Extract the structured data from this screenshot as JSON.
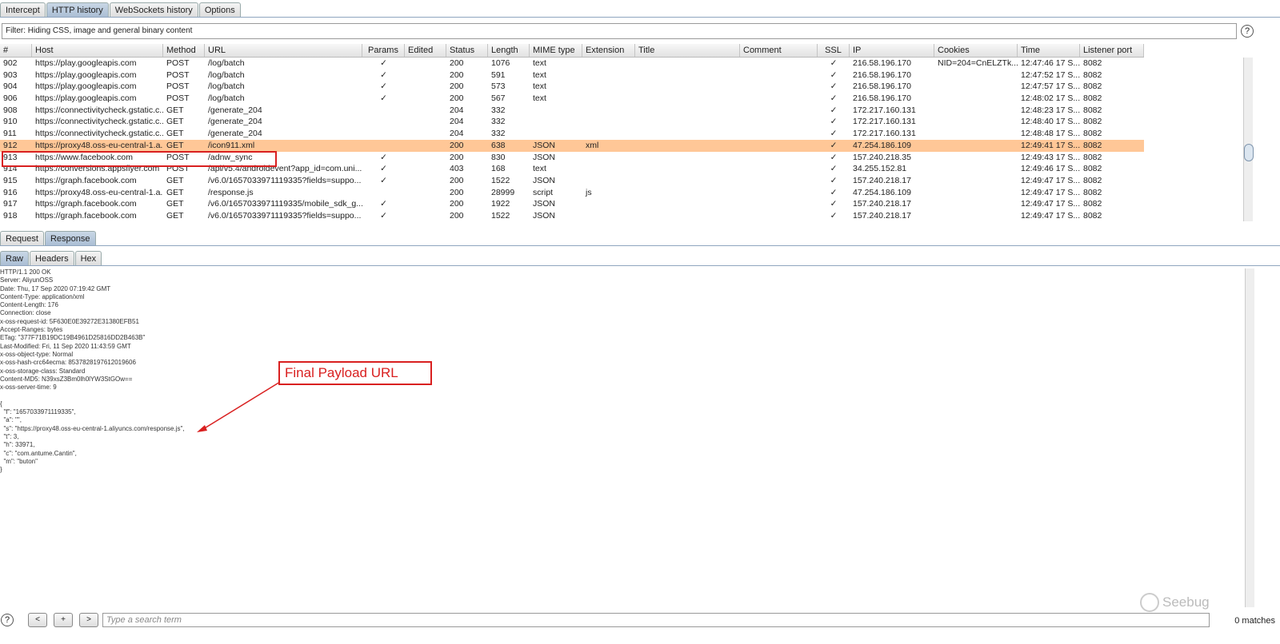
{
  "top_tabs": [
    "Intercept",
    "HTTP history",
    "WebSockets history",
    "Options"
  ],
  "filter": "Filter: Hiding CSS, image and general binary content",
  "columns": [
    "#",
    "Host",
    "Method",
    "URL",
    "Params",
    "Edited",
    "Status",
    "Length",
    "MIME type",
    "Extension",
    "Title",
    "Comment",
    "SSL",
    "IP",
    "Cookies",
    "Time",
    "Listener port"
  ],
  "rows": [
    [
      "902",
      "https://play.googleapis.com",
      "POST",
      "/log/batch",
      "✓",
      "",
      "200",
      "1076",
      "text",
      "",
      "",
      "",
      "✓",
      "216.58.196.170",
      "NID=204=CnELZTk...",
      "12:47:46 17 S...",
      "8082"
    ],
    [
      "903",
      "https://play.googleapis.com",
      "POST",
      "/log/batch",
      "✓",
      "",
      "200",
      "591",
      "text",
      "",
      "",
      "",
      "✓",
      "216.58.196.170",
      "",
      "12:47:52 17 S...",
      "8082"
    ],
    [
      "904",
      "https://play.googleapis.com",
      "POST",
      "/log/batch",
      "✓",
      "",
      "200",
      "573",
      "text",
      "",
      "",
      "",
      "✓",
      "216.58.196.170",
      "",
      "12:47:57 17 S...",
      "8082"
    ],
    [
      "906",
      "https://play.googleapis.com",
      "POST",
      "/log/batch",
      "✓",
      "",
      "200",
      "567",
      "text",
      "",
      "",
      "",
      "✓",
      "216.58.196.170",
      "",
      "12:48:02 17 S...",
      "8082"
    ],
    [
      "908",
      "https://connectivitycheck.gstatic.c...",
      "GET",
      "/generate_204",
      "",
      "",
      "204",
      "332",
      "",
      "",
      "",
      "",
      "✓",
      "172.217.160.131",
      "",
      "12:48:23 17 S...",
      "8082"
    ],
    [
      "910",
      "https://connectivitycheck.gstatic.c...",
      "GET",
      "/generate_204",
      "",
      "",
      "204",
      "332",
      "",
      "",
      "",
      "",
      "✓",
      "172.217.160.131",
      "",
      "12:48:40 17 S...",
      "8082"
    ],
    [
      "911",
      "https://connectivitycheck.gstatic.c...",
      "GET",
      "/generate_204",
      "",
      "",
      "204",
      "332",
      "",
      "",
      "",
      "",
      "✓",
      "172.217.160.131",
      "",
      "12:48:48 17 S...",
      "8082"
    ],
    [
      "912",
      "https://proxy48.oss-eu-central-1.a...",
      "GET",
      "/icon911.xml",
      "",
      "",
      "200",
      "638",
      "JSON",
      "xml",
      "",
      "",
      "✓",
      "47.254.186.109",
      "",
      "12:49:41 17 S...",
      "8082"
    ],
    [
      "913",
      "https://www.facebook.com",
      "POST",
      "/adnw_sync",
      "✓",
      "",
      "200",
      "830",
      "JSON",
      "",
      "",
      "",
      "✓",
      "157.240.218.35",
      "",
      "12:49:43 17 S...",
      "8082"
    ],
    [
      "914",
      "https://conversions.appsflyer.com",
      "POST",
      "/api/v5.4/androidevent?app_id=com.uni...",
      "✓",
      "",
      "403",
      "168",
      "text",
      "",
      "",
      "",
      "✓",
      "34.255.152.81",
      "",
      "12:49:46 17 S...",
      "8082"
    ],
    [
      "915",
      "https://graph.facebook.com",
      "GET",
      "/v6.0/1657033971119335?fields=suppo...",
      "✓",
      "",
      "200",
      "1522",
      "JSON",
      "",
      "",
      "",
      "✓",
      "157.240.218.17",
      "",
      "12:49:47 17 S...",
      "8082"
    ],
    [
      "916",
      "https://proxy48.oss-eu-central-1.a...",
      "GET",
      "/response.js",
      "",
      "",
      "200",
      "28999",
      "script",
      "js",
      "",
      "",
      "✓",
      "47.254.186.109",
      "",
      "12:49:47 17 S...",
      "8082"
    ],
    [
      "917",
      "https://graph.facebook.com",
      "GET",
      "/v6.0/1657033971119335/mobile_sdk_g...",
      "✓",
      "",
      "200",
      "1922",
      "JSON",
      "",
      "",
      "",
      "✓",
      "157.240.218.17",
      "",
      "12:49:47 17 S...",
      "8082"
    ],
    [
      "918",
      "https://graph.facebook.com",
      "GET",
      "/v6.0/1657033971119335?fields=suppo...",
      "✓",
      "",
      "200",
      "1522",
      "JSON",
      "",
      "",
      "",
      "✓",
      "157.240.218.17",
      "",
      "12:49:47 17 S...",
      "8082"
    ]
  ],
  "selected_row": "912",
  "msg_tabs": [
    "Request",
    "Response"
  ],
  "view_tabs": [
    "Raw",
    "Headers",
    "Hex"
  ],
  "response_raw": "HTTP/1.1 200 OK\nServer: AliyunOSS\nDate: Thu, 17 Sep 2020 07:19:42 GMT\nContent-Type: application/xml\nContent-Length: 176\nConnection: close\nx-oss-request-id: 5F630E0E39272E31380EFB51\nAccept-Ranges: bytes\nETag: \"377F71B19DC19B4961D25816DD2B463B\"\nLast-Modified: Fri, 11 Sep 2020 11:43:59 GMT\nx-oss-object-type: Normal\nx-oss-hash-crc64ecma: 8537828197612019606\nx-oss-storage-class: Standard\nContent-MD5: N39xsZ3Bm0lh0lYW3StGOw==\nx-oss-server-time: 9\n\n{\n  \"f\": \"1657033971119335\",\n  \"a\": \"\",\n  \"s\": \"https://proxy48.oss-eu-central-1.aliyuncs.com/response.js\",\n  \"t\": 3,\n  \"h\": 33971,\n  \"c\": \"com.antume.Cantin\",\n  \"m\": \"buton\"\n}",
  "annotation": "Final Payload URL",
  "search": {
    "placeholder": "Type a search term",
    "prev": "<",
    "add": "+",
    "next": ">",
    "matches": "0 matches"
  },
  "watermark": "Seebug",
  "help": "?"
}
